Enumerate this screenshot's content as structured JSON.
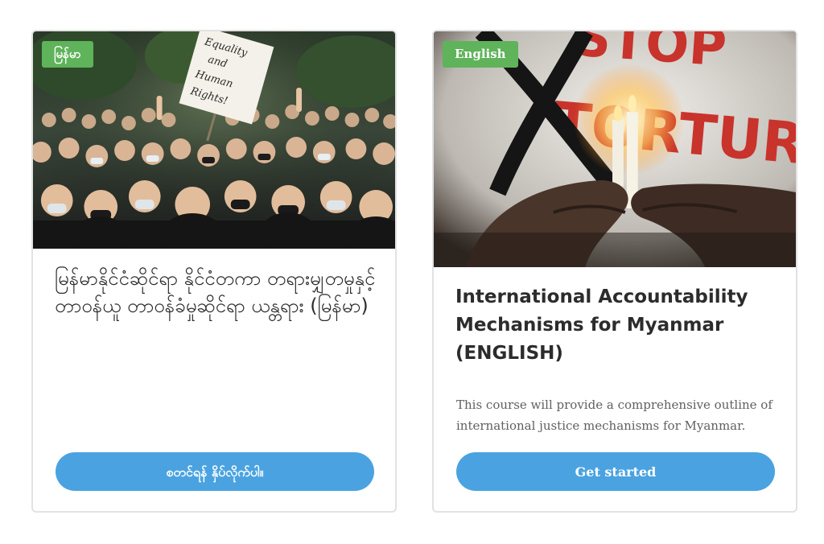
{
  "colors": {
    "tag_green": "#5fb35a",
    "button_blue": "#4aa3e0",
    "title_text": "#2c2c2c",
    "body_text": "#606060",
    "card_border": "#e2e2e2"
  },
  "courses": [
    {
      "tag": "မြန်မာ",
      "image": {
        "icon": "protest-crowd-photo",
        "sign_lines": [
          "Equality",
          "and",
          "Human",
          "Rights!"
        ]
      },
      "title": "မြန်မာနိုင်ငံဆိုင်ရာ နိုင်ငံတကာ တရားမျှတမှုနှင့် တာဝန်ယူ တာဝန်ခံမှုဆိုင်ရာ ယန္တရား (မြန်မာ)",
      "description": "",
      "button_label": "စတင်ရန် နှိပ်လိုက်ပါ။"
    },
    {
      "tag": "English",
      "image": {
        "icon": "candle-vigil-photo",
        "shirt_lines": [
          "STOP",
          "TORTURE"
        ]
      },
      "title": "International Accountability Mechanisms for Myanmar (ENGLISH)",
      "description": "This course will provide a comprehensive outline of international justice mechanisms for Myanmar.",
      "button_label": "Get started"
    }
  ]
}
